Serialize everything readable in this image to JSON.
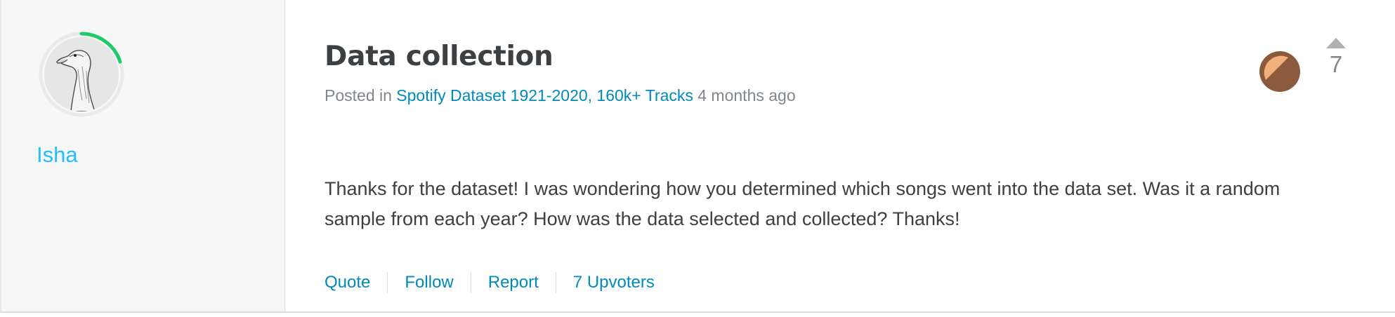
{
  "author": {
    "name": "Isha",
    "avatar_icon": "goose-avatar-icon",
    "progress": 0.2,
    "ring_color": "#1fcb67"
  },
  "post": {
    "title": "Data collection",
    "posted_in_prefix": "Posted in",
    "dataset_link": "Spotify Dataset 1921-2020, 160k+ Tracks",
    "time_ago": "4 months ago",
    "body": "Thanks for the dataset! I was wondering how you determined which songs went into the data set. Was it a random sample from each year? How was the data selected and collected? Thanks!"
  },
  "actions": {
    "quote": "Quote",
    "follow": "Follow",
    "report": "Report",
    "upvoters": "7 Upvoters"
  },
  "vote": {
    "count": "7",
    "medal_icon": "bronze-medal-icon"
  },
  "colors": {
    "link": "#008abc",
    "author": "#20beff",
    "medal_light": "#f0b27a",
    "medal_dark": "#8b5a3c"
  }
}
